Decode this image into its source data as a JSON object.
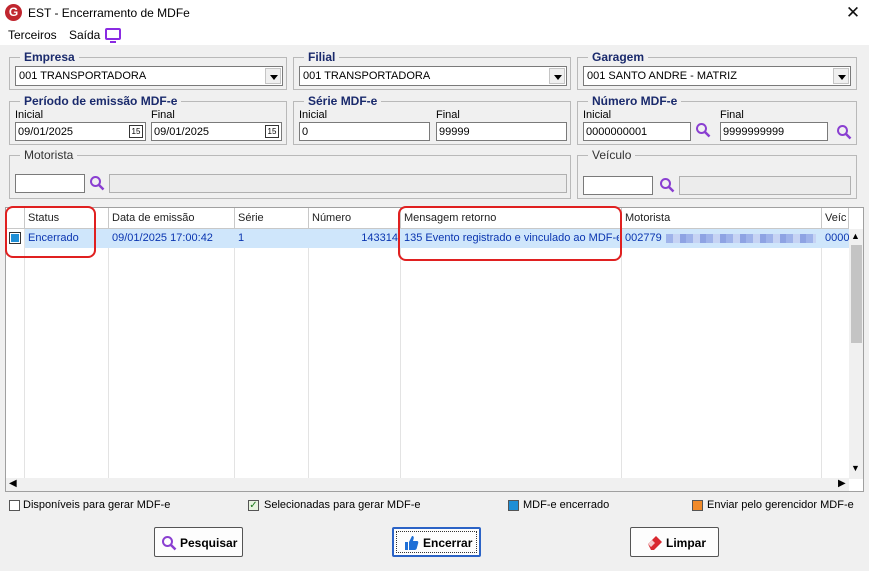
{
  "window": {
    "title": "EST - Encerramento de MDFe",
    "close": "✕"
  },
  "menu": {
    "items": [
      "Terceiros",
      "Saída"
    ]
  },
  "filters": {
    "empresa": {
      "label": "Empresa",
      "value": "001 TRANSPORTADORA"
    },
    "filial": {
      "label": "Filial",
      "value": "001 TRANSPORTADORA"
    },
    "garagem": {
      "label": "Garagem",
      "value": "001 SANTO ANDRE - MATRIZ"
    },
    "periodo": {
      "label": "Período de emissão MDF-e",
      "inicial_label": "Inicial",
      "inicial": "09/01/2025",
      "final_label": "Final",
      "final": "09/01/2025"
    },
    "serie": {
      "label": "Série MDF-e",
      "inicial_label": "Inicial",
      "inicial": "0",
      "final_label": "Final",
      "final": "99999"
    },
    "numero": {
      "label": "Número MDF-e",
      "inicial_label": "Inicial",
      "inicial": "0000000001",
      "final_label": "Final",
      "final": "9999999999"
    },
    "motorista": {
      "label": "Motorista",
      "value": ""
    },
    "veiculo": {
      "label": "Veículo",
      "value": ""
    }
  },
  "grid": {
    "columns": [
      "Status",
      "Data de emissão",
      "Série",
      "Número",
      "Mensagem retorno",
      "Motorista",
      "Veíc"
    ],
    "rows": [
      {
        "status": "Encerrado",
        "data_emissao": "09/01/2025 17:00:42",
        "serie": "1",
        "numero": "143314",
        "mensagem": "135 Evento registrado e vinculado ao MDF-e",
        "motorista": "002779",
        "veiculo": "0000"
      }
    ]
  },
  "legend": [
    {
      "label": "Disponíveis para gerar MDF-e",
      "color": "#ffffff"
    },
    {
      "label": "Selecionadas para gerar MDF-e",
      "color": "#e8f4e0"
    },
    {
      "label": "MDF-e encerrado",
      "color": "#1f8fd6"
    },
    {
      "label": "Enviar pelo gerencidor MDF-e",
      "color": "#f08a2a"
    }
  ],
  "buttons": {
    "pesquisar": "Pesquisar",
    "encerrar": "Encerrar",
    "limpar": "Limpar"
  },
  "icons": {
    "app": "G",
    "calendar": "15",
    "check": "✓"
  },
  "colors": {
    "accent_text": "#0a35b0",
    "highlight": "#e02020",
    "selection": "#cfe6fb"
  }
}
